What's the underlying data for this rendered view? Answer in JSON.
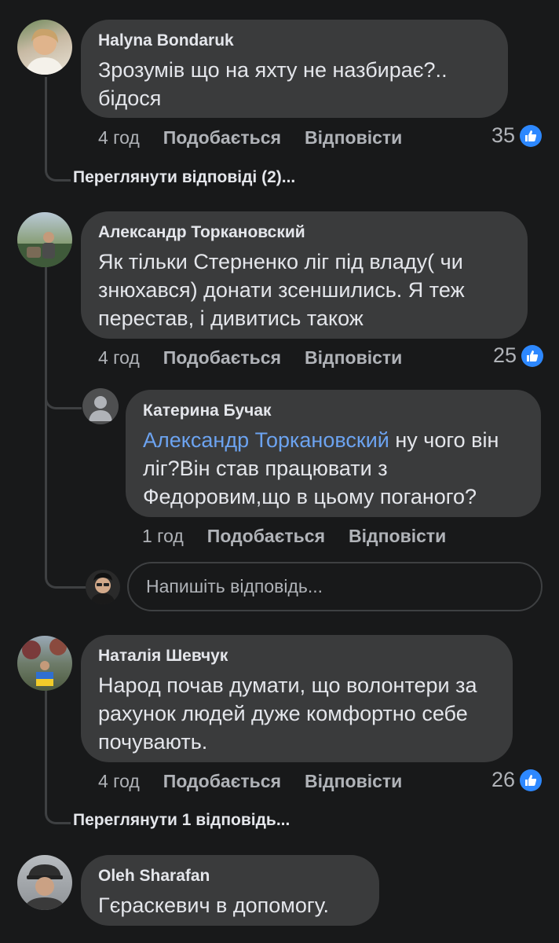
{
  "comments": [
    {
      "author": "Halyna Bondaruk",
      "text": "Зрозумів що на яхту не назбирає?.. бідося",
      "time": "4 год",
      "like_label": "Подобається",
      "reply_label": "Відповісти",
      "likes": "35",
      "view_replies": "Переглянути відповіді (2)..."
    },
    {
      "author": "Александр Торкановский",
      "text": "Як тільки Стерненко ліг під владу( чи знюхався) донати зсеншились. Я теж перестав, і дивитись також",
      "time": "4 год",
      "like_label": "Подобається",
      "reply_label": "Відповісти",
      "likes": "25"
    },
    {
      "author": "Наталія Шевчук",
      "text": "Народ почав думати, що волонтери за рахунок людей дуже комфортно себе почувають.",
      "time": "4 год",
      "like_label": "Подобається",
      "reply_label": "Відповісти",
      "likes": "26",
      "view_replies": "Переглянути 1 відповідь..."
    },
    {
      "author": "Oleh Sharafan",
      "text": "Гєраскевич в допомогу."
    }
  ],
  "reply": {
    "author": "Катерина Бучак",
    "mention": "Александр Торкановский",
    "text": " ну чого він ліг?Він став працювати з Федоровим,що в цьому поганого?",
    "time": "1 год",
    "like_label": "Подобається",
    "reply_label": "Відповісти"
  },
  "reply_input": {
    "placeholder": "Напишіть відповідь..."
  },
  "colors": {
    "background": "#18191a",
    "bubble": "#3a3b3c",
    "mention": "#6ca3f0",
    "like": "#2d88ff"
  },
  "icons": {
    "like": "thumbs-up-icon",
    "default_avatar": "default-avatar-icon"
  }
}
